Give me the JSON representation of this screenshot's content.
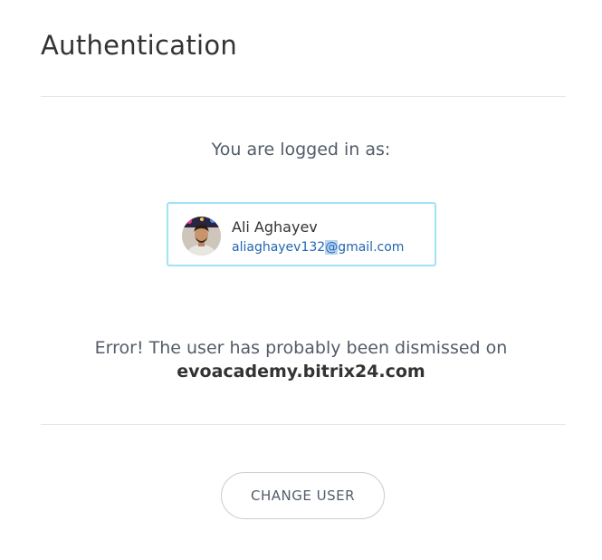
{
  "page": {
    "title": "Authentication",
    "logged_in_label": "You are logged in as:"
  },
  "user": {
    "name": "Ali Aghayev",
    "email_before_selection": "aliaghayev132",
    "email_selected": "@",
    "email_after_selection": "gmail.com",
    "avatar_icon": "user-avatar-photo"
  },
  "error": {
    "message": "Error! The user has probably been dismissed on",
    "domain": "evoacademy.bitrix24.com"
  },
  "actions": {
    "change_user_label": "CHANGE USER"
  },
  "colors": {
    "card_border": "#9fe3f4",
    "email_link": "#2067b0",
    "text_muted": "#525c69",
    "selection_highlight": "#b8d4f2"
  }
}
